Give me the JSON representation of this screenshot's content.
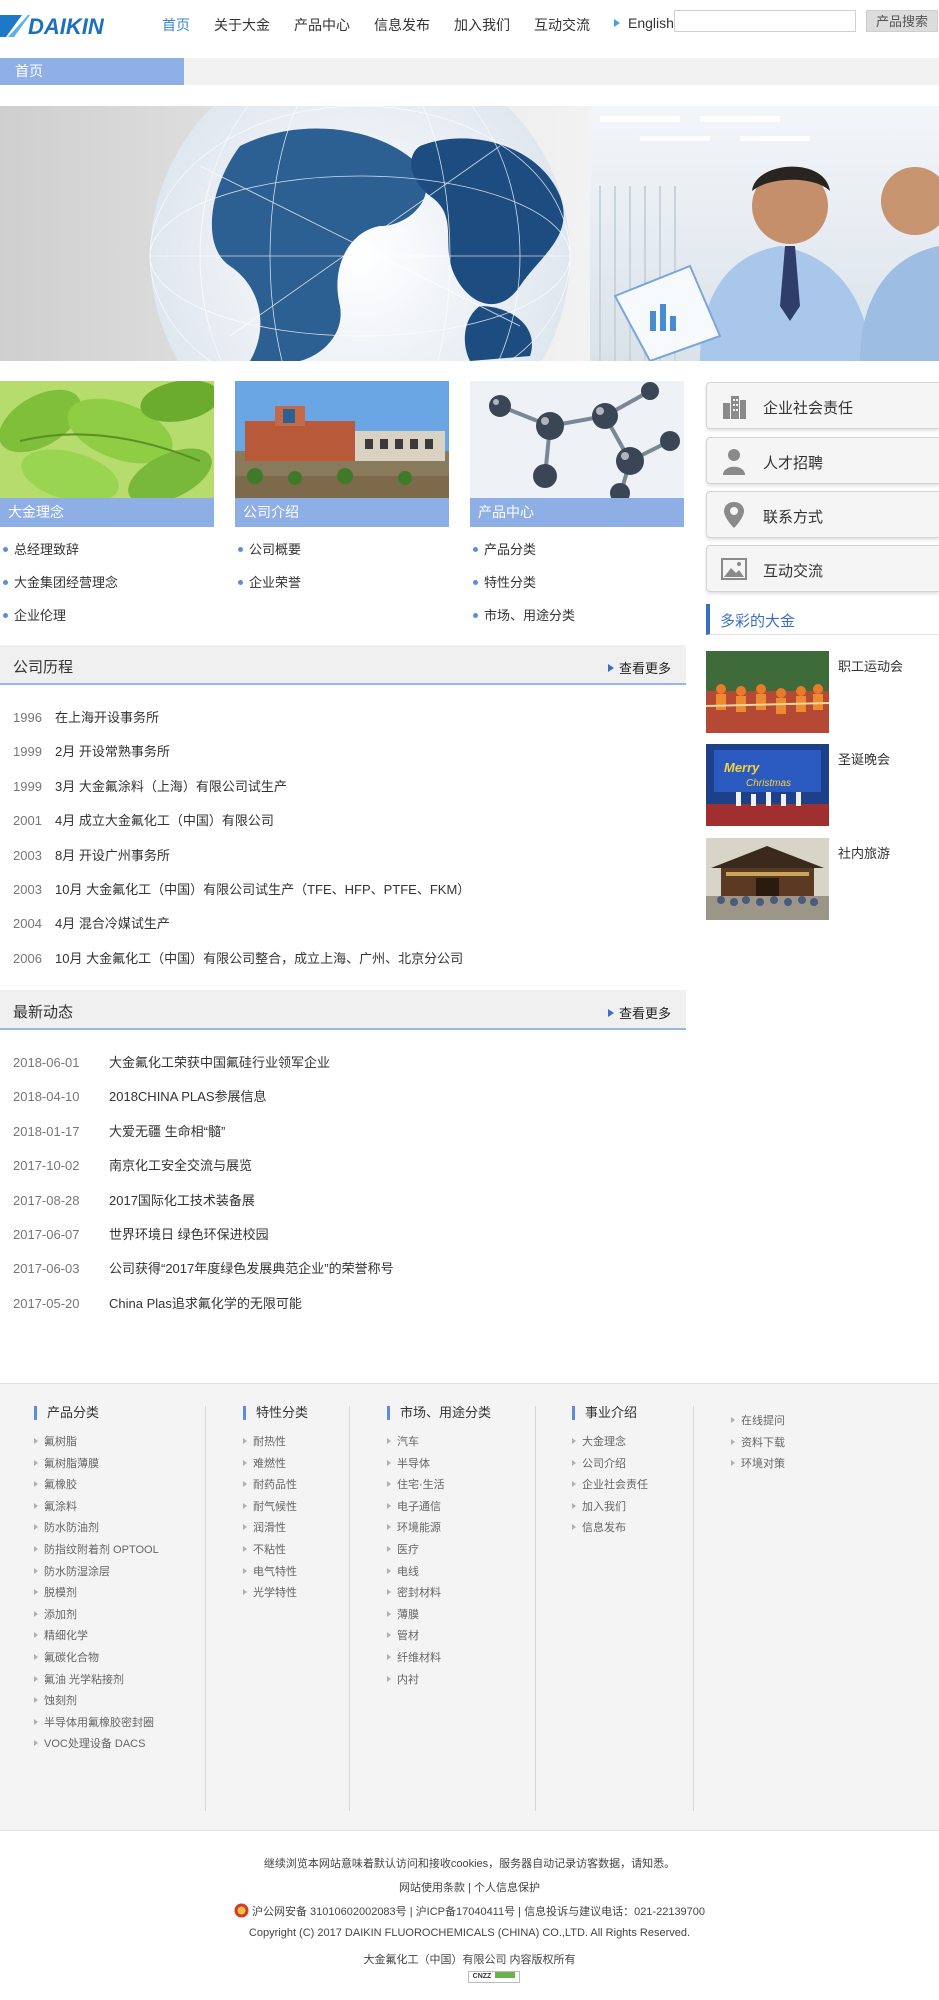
{
  "header": {
    "logo_text": "DAIKIN",
    "nav": [
      "首页",
      "关于大金",
      "产品中心",
      "信息发布",
      "加入我们",
      "互动交流"
    ],
    "english_label": "English",
    "search_placeholder": "",
    "search_button": "产品搜索"
  },
  "breadcrumb": {
    "home": "首页"
  },
  "cards": [
    {
      "title": "大金理念",
      "items": [
        "总经理致辞",
        "大金集团经营理念",
        "企业伦理"
      ]
    },
    {
      "title": "公司介绍",
      "items": [
        "公司概要",
        "企业荣誉"
      ]
    },
    {
      "title": "产品中心",
      "items": [
        "产品分类",
        "特性分类",
        "市场、用途分类"
      ]
    }
  ],
  "history": {
    "title": "公司历程",
    "more": "查看更多",
    "rows": [
      {
        "year": "1996",
        "text": "在上海开设事务所"
      },
      {
        "year": "1999",
        "text": "2月 开设常熟事务所"
      },
      {
        "year": "1999",
        "text": "3月 大金氟涂料（上海）有限公司试生产"
      },
      {
        "year": "2001",
        "text": "4月 成立大金氟化工（中国）有限公司"
      },
      {
        "year": "2003",
        "text": "8月 开设广州事务所"
      },
      {
        "year": "2003",
        "text": "10月 大金氟化工（中国）有限公司试生产（TFE、HFP、PTFE、FKM）"
      },
      {
        "year": "2004",
        "text": "4月 混合冷媒试生产"
      },
      {
        "year": "2006",
        "text": "10月 大金氟化工（中国）有限公司整合，成立上海、广州、北京分公司"
      }
    ]
  },
  "news": {
    "title": "最新动态",
    "more": "查看更多",
    "rows": [
      {
        "date": "2018-06-01",
        "text": "大金氟化工荣获中国氟硅行业领军企业"
      },
      {
        "date": "2018-04-10",
        "text": "2018CHINA PLAS参展信息"
      },
      {
        "date": "2018-01-17",
        "text": "大爱无疆 生命相“髓”"
      },
      {
        "date": "2017-10-02",
        "text": "南京化工安全交流与展览"
      },
      {
        "date": "2017-08-28",
        "text": "2017国际化工技术装备展"
      },
      {
        "date": "2017-06-07",
        "text": "世界环境日 绿色环保进校园"
      },
      {
        "date": "2017-06-03",
        "text": "公司获得“2017年度绿色发展典范企业”的荣誉称号"
      },
      {
        "date": "2017-05-20",
        "text": "China Plas追求氟化学的无限可能"
      }
    ]
  },
  "side_buttons": [
    {
      "label": "企业社会责任",
      "icon": "building-icon"
    },
    {
      "label": "人才招聘",
      "icon": "person-icon"
    },
    {
      "label": "联系方式",
      "icon": "location-pin-icon"
    },
    {
      "label": "互动交流",
      "icon": "picture-icon"
    }
  ],
  "colorful": {
    "title": "多彩的大金",
    "items": [
      "职工运动会",
      "圣诞晚会",
      "社内旅游"
    ]
  },
  "footer_columns": [
    {
      "title": "产品分类",
      "items": [
        "氟树脂",
        "氟树脂薄膜",
        "氟橡胶",
        "氟涂料",
        "防水防油剂",
        "防指纹附着剂 OPTOOL",
        "防水防湿涂层",
        "脱模剂",
        "添加剂",
        "精细化学",
        "氟碳化合物",
        "氟油 光学粘接剂",
        "蚀刻剂",
        "半导体用氟橡胶密封圈",
        "VOC处理设备 DACS"
      ]
    },
    {
      "title": "特性分类",
      "items": [
        "耐热性",
        "难燃性",
        "耐药品性",
        "耐气候性",
        "润滑性",
        "不粘性",
        "电气特性",
        "光学特性"
      ]
    },
    {
      "title": "市场、用途分类",
      "items": [
        "汽车",
        "半导体",
        "住宅·生活",
        "电子通信",
        "环境能源",
        "医疗",
        "电线",
        "密封材料",
        "薄膜",
        "管材",
        "纤维材料",
        "内衬"
      ]
    },
    {
      "title": "事业介绍",
      "items": [
        "大金理念",
        "公司介绍",
        "企业社会责任",
        "加入我们",
        "信息发布"
      ]
    }
  ],
  "footer_extra_links": [
    "在线提问",
    "资料下载",
    "环境对策"
  ],
  "footer_bottom": {
    "cookie_notice": "继续浏览本网站意味着默认访问和接收cookies，服务器自动记录访客数据，请知悉。",
    "terms": "网站使用条款 | 个人信息保护",
    "icp": "沪公网安备 31010602002083号 | 沪ICP备17040411号 | 信息投诉与建议电话：021-22139700",
    "copyright": "Copyright (C) 2017 DAIKIN FLUOROCHEMICALS (CHINA) CO.,LTD.    All Rights Reserved.",
    "owner": "大金氟化工（中国）有限公司 内容版权所有",
    "badge": "CNZZ"
  },
  "colors": {
    "accent": "#3a86d4",
    "bar": "#8eaee6",
    "brand_blue": "#1e78c8"
  }
}
